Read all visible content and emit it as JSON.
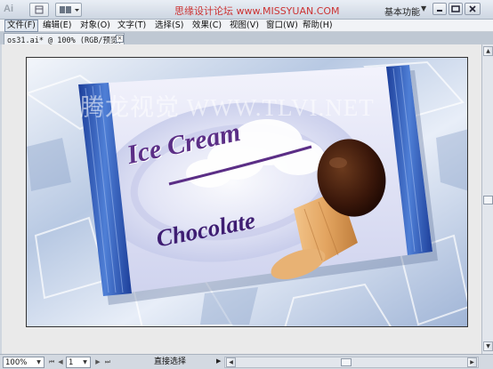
{
  "app": {
    "logo": "Ai",
    "icons": [
      "bridge-icon",
      "arrange-documents-icon"
    ]
  },
  "title_watermark": "思缘设计论坛  www.MISSYUAN.COM",
  "workspace": {
    "label": "基本功能"
  },
  "window_controls": [
    "minimize-icon",
    "restore-icon",
    "close-icon"
  ],
  "menu": [
    {
      "label": "文件(F)",
      "active": true
    },
    {
      "label": "编辑(E)"
    },
    {
      "label": "对象(O)"
    },
    {
      "label": "文字(T)"
    },
    {
      "label": "选择(S)"
    },
    {
      "label": "效果(C)"
    },
    {
      "label": "视图(V)"
    },
    {
      "label": "窗口(W)"
    },
    {
      "label": "帮助(H)"
    }
  ],
  "document_tab": {
    "label": "os31.ai* @ 100% (RGB/预览)",
    "close": "×"
  },
  "artwork": {
    "watermark": "腾龙视觉 WWW.TLVI.NET",
    "title": "Ice Cream",
    "subtitle": "Chocolate",
    "colors": {
      "ice_blue": "#c9d8ee",
      "wrapper_blue": "#2f5fb8",
      "wrapper_light": "#eef0fb",
      "text_purple": "#5b2e86",
      "cone": "#e1a461",
      "chocolate": "#3b1a0c"
    }
  },
  "statusbar": {
    "zoom": "100%",
    "page": "1",
    "tool": "直接选择"
  }
}
